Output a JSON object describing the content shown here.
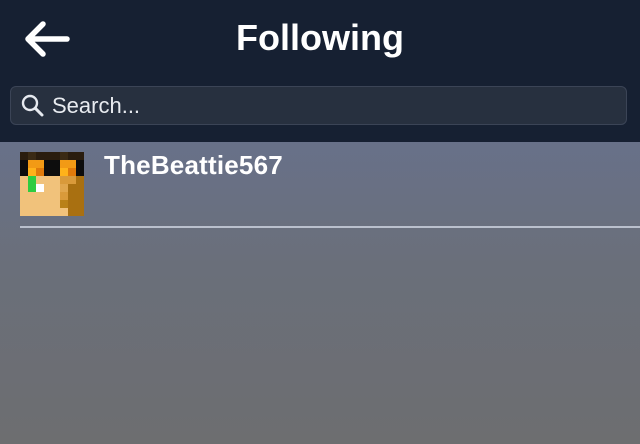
{
  "header": {
    "title": "Following",
    "back_icon": "arrow-left-icon"
  },
  "search": {
    "placeholder": "Search...",
    "value": "",
    "icon": "search-icon"
  },
  "following": [
    {
      "username": "TheBeattie567",
      "avatar_icon": "pixel-skin-avatar"
    }
  ],
  "colors": {
    "header_bg": "#162032",
    "search_bg": "#27303f",
    "text": "#ffffff",
    "content_bg_top": "#626f92",
    "content_bg_bottom": "#6d6e70"
  }
}
